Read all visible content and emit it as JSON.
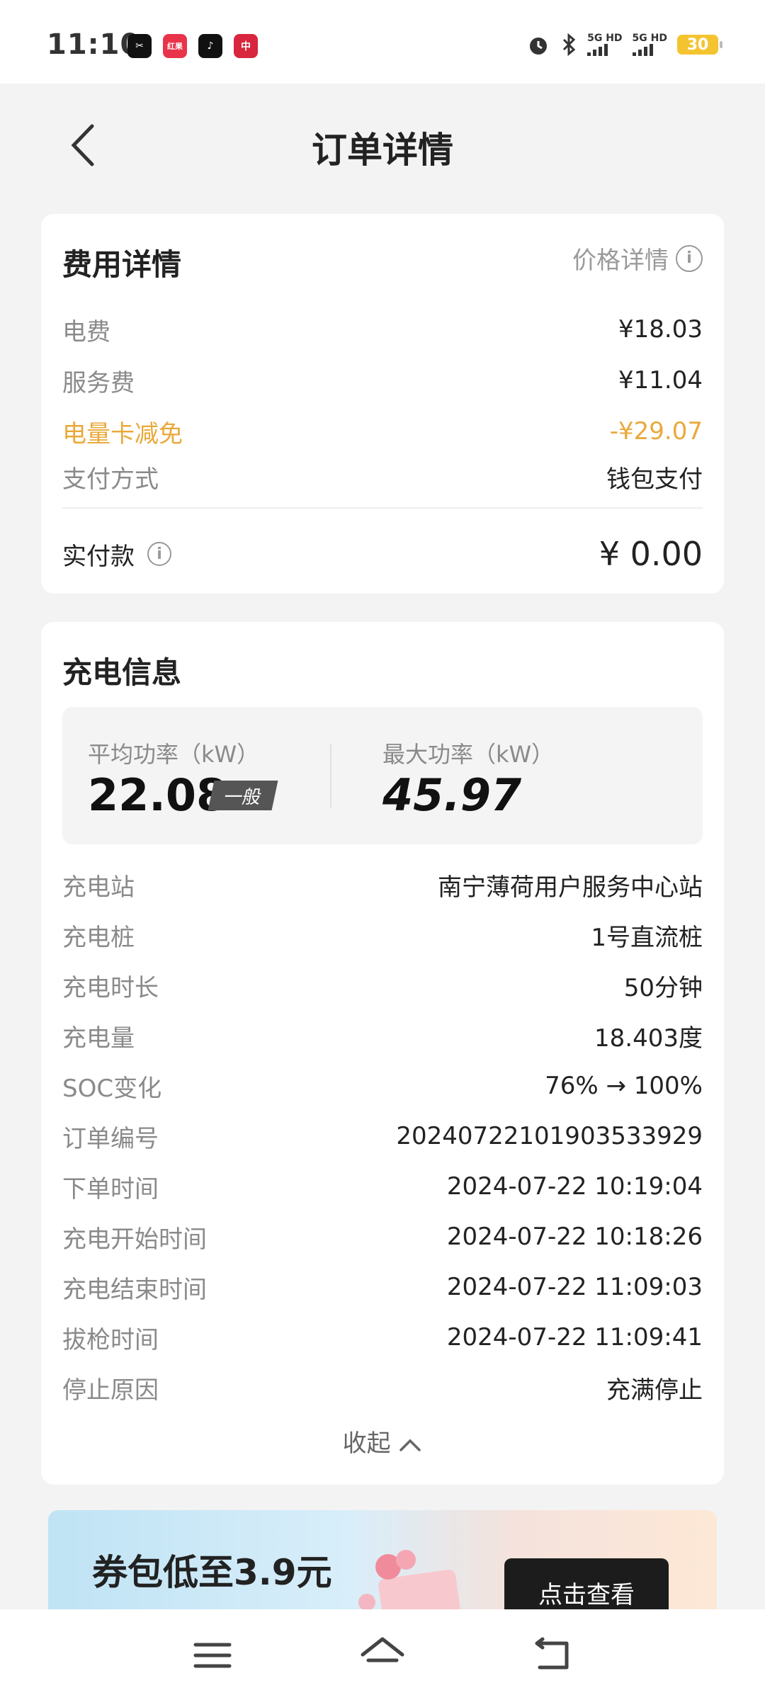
{
  "status_bar": {
    "time": "11:10",
    "apps": [
      {
        "icon": "capcut-icon",
        "color": "#111111",
        "label": "✂"
      },
      {
        "icon": "hongguo-icon",
        "color": "#e8334a",
        "label": "红果"
      },
      {
        "icon": "douyin-icon",
        "color": "#111111",
        "label": "♪"
      },
      {
        "icon": "citic-bank-icon",
        "color": "#d7263d",
        "label": "中"
      }
    ],
    "signal_1": "5G HD",
    "signal_2": "5G HD",
    "battery": "30"
  },
  "header": {
    "title": "订单详情"
  },
  "fee_card": {
    "title": "费用详情",
    "price_detail_link": "价格详情",
    "rows": [
      {
        "label": "电费",
        "value": "¥18.03"
      },
      {
        "label": "服务费",
        "value": "¥11.04"
      },
      {
        "label": "电量卡减免",
        "value": "-¥29.07"
      },
      {
        "label": "支付方式",
        "value": "钱包支付"
      }
    ],
    "paid_label": "实付款",
    "paid_value": "¥ 0.00"
  },
  "charge_card": {
    "title": "充电信息",
    "avg_power_label": "平均功率（kW）",
    "avg_power_value": "22.08",
    "avg_power_badge": "一般",
    "max_power_label": "最大功率（kW）",
    "max_power_value": "45.97",
    "rows": [
      {
        "label": "充电站",
        "value": "南宁薄荷用户服务中心站"
      },
      {
        "label": "充电桩",
        "value": "1号直流桩"
      },
      {
        "label": "充电时长",
        "value": "50分钟"
      },
      {
        "label": "充电量",
        "value": "18.403度"
      },
      {
        "label": "SOC变化",
        "value": "76% → 100%"
      },
      {
        "label": "订单编号",
        "value": "20240722101903533929"
      },
      {
        "label": "下单时间",
        "value": "2024-07-22 10:19:04"
      },
      {
        "label": "充电开始时间",
        "value": "2024-07-22 10:18:26"
      },
      {
        "label": "充电结束时间",
        "value": "2024-07-22 11:09:03"
      },
      {
        "label": "拔枪时间",
        "value": "2024-07-22 11:09:41"
      },
      {
        "label": "停止原因",
        "value": "充满停止"
      }
    ],
    "collapse_label": "收起"
  },
  "banner": {
    "title": "券包低至3.9元",
    "button": "点击查看"
  },
  "colors": {
    "accent_discount": "#e9a93a",
    "background": "#f3f3f3"
  }
}
